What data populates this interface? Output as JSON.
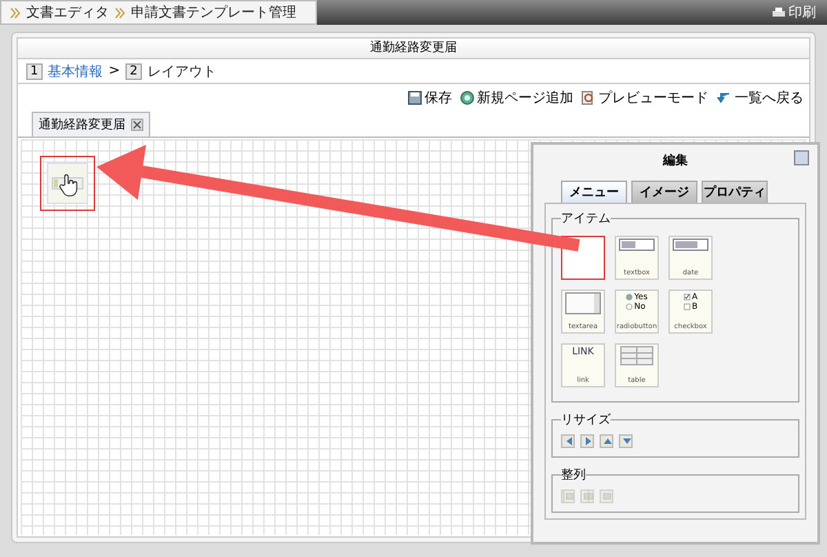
{
  "breadcrumb": [
    "文書エディタ",
    "申請文書テンプレート管理"
  ],
  "print": "印刷",
  "form_title": "通勤経路変更届",
  "steps": [
    {
      "number": "1",
      "label": "基本情報",
      "selected": false
    },
    {
      "number": "2",
      "label": "レイアウト",
      "selected": true
    }
  ],
  "step_separator": ">",
  "toolbar": [
    {
      "kind": "save",
      "label": "保存"
    },
    {
      "kind": "add",
      "label": "新規ページ追加"
    },
    {
      "kind": "preview",
      "label": "プレビューモード"
    },
    {
      "kind": "back",
      "label": "一覧へ戻る"
    }
  ],
  "page_tabs": [
    {
      "label": "通勤経路変更届",
      "selected": true
    }
  ],
  "canvas": {
    "element_selected": true
  },
  "dialog": {
    "title": "編集",
    "tabs": [
      {
        "label": "メニュー",
        "selected": true
      },
      {
        "label": "イメージ",
        "selected": false
      },
      {
        "label": "プロパティ",
        "selected": false
      }
    ],
    "items_group": "アイテム",
    "items": [
      {
        "kind": "blank",
        "selected": true
      },
      {
        "kind": "textbox",
        "label": "textbox",
        "selected": false
      },
      {
        "kind": "date",
        "label": "date",
        "selected": false
      },
      {
        "kind": "textarea",
        "label": "textarea",
        "selected": false
      },
      {
        "kind": "radio",
        "label": "radiobutton",
        "options": [
          "Yes",
          "No"
        ],
        "selected": false
      },
      {
        "kind": "checkbox",
        "label": "checkbox",
        "options": [
          "A",
          "B"
        ],
        "selected": false
      },
      {
        "kind": "link",
        "label": "link",
        "text": "LINK",
        "selected": false
      },
      {
        "kind": "table",
        "label": "table",
        "selected": false
      }
    ],
    "resize_group": "リサイズ",
    "resize_buttons": [
      {
        "kind": "left"
      },
      {
        "kind": "right"
      },
      {
        "kind": "up"
      },
      {
        "kind": "down"
      }
    ],
    "align_group": "整列",
    "align_buttons": [
      {
        "kind": "left",
        "disabled": true
      },
      {
        "kind": "center",
        "disabled": true
      },
      {
        "kind": "right",
        "disabled": true
      }
    ]
  }
}
